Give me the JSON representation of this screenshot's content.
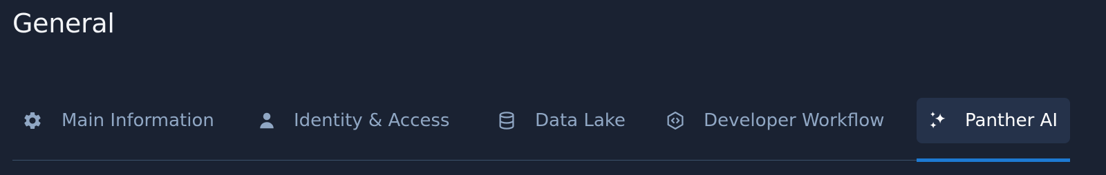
{
  "page": {
    "title": "General"
  },
  "tabs": [
    {
      "id": "main-information",
      "label": "Main Information",
      "icon": "gear-icon",
      "active": false
    },
    {
      "id": "identity-access",
      "label": "Identity & Access",
      "icon": "user-icon",
      "active": false
    },
    {
      "id": "data-lake",
      "label": "Data Lake",
      "icon": "database-icon",
      "active": false
    },
    {
      "id": "developer-workflow",
      "label": "Developer Workflow",
      "icon": "code-hexagon-icon",
      "active": false
    },
    {
      "id": "panther-ai",
      "label": "Panther AI",
      "icon": "sparkles-icon",
      "active": true
    }
  ],
  "colors": {
    "background": "#1a2232",
    "inactive_text": "#90a7c4",
    "active_text": "#ffffff",
    "active_bg": "#25324a",
    "accent": "#1d7ad2",
    "divider": "#3d536b"
  }
}
